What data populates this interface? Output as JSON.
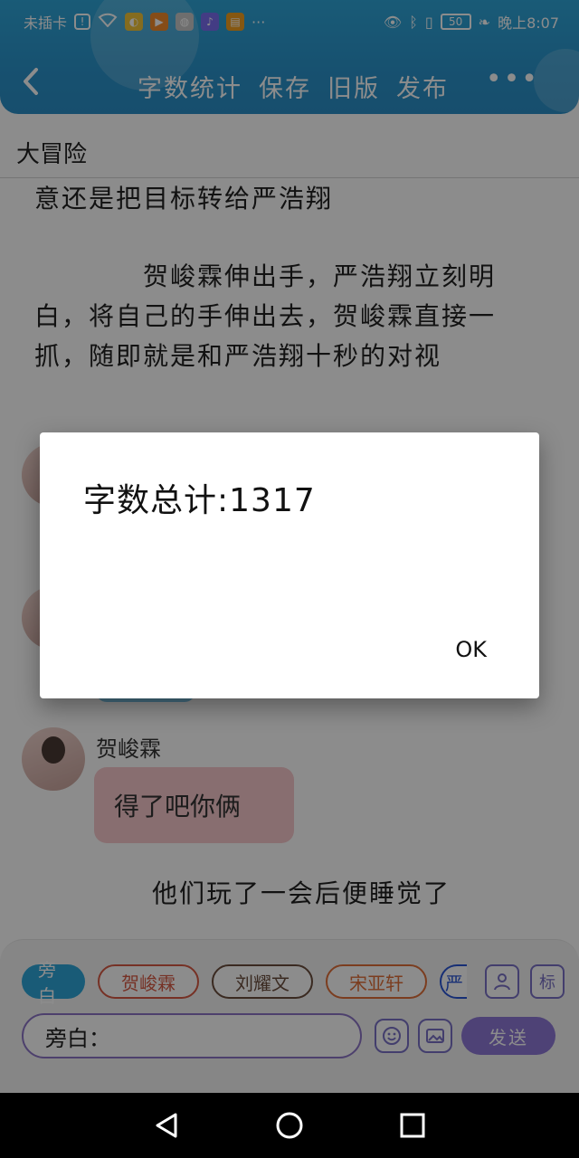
{
  "status_bar": {
    "carrier": "未插卡",
    "time": "晚上8:07",
    "battery": "50",
    "more": "···"
  },
  "header": {
    "tabs": [
      "字数统计",
      "保存",
      "旧版",
      "发布"
    ],
    "more": "•••"
  },
  "document": {
    "title": "大冒险",
    "paragraph_1": "意还是把目标转给严浩翔",
    "paragraph_2": "　　　　贺峻霖伸出手，严浩翔立刻明白，将自己的手伸出去，贺峻霖直接一抓，随即就是和严浩翔十秒的对视",
    "speaker_name": "贺峻霖",
    "message": "得了吧你俩",
    "narration": "他们玩了一会后便睡觉了"
  },
  "composer": {
    "chips": [
      "旁白",
      "贺峻霖",
      "刘耀文",
      "宋亚轩",
      "严"
    ],
    "input_value": "旁白：",
    "send_label": "发送",
    "tag_label": "标"
  },
  "dialog": {
    "message": "字数总计:1317",
    "ok_label": "OK"
  },
  "colors": {
    "header": "#2a94cc",
    "accent": "#8e78d8",
    "bubble": "#f7c8cc"
  }
}
